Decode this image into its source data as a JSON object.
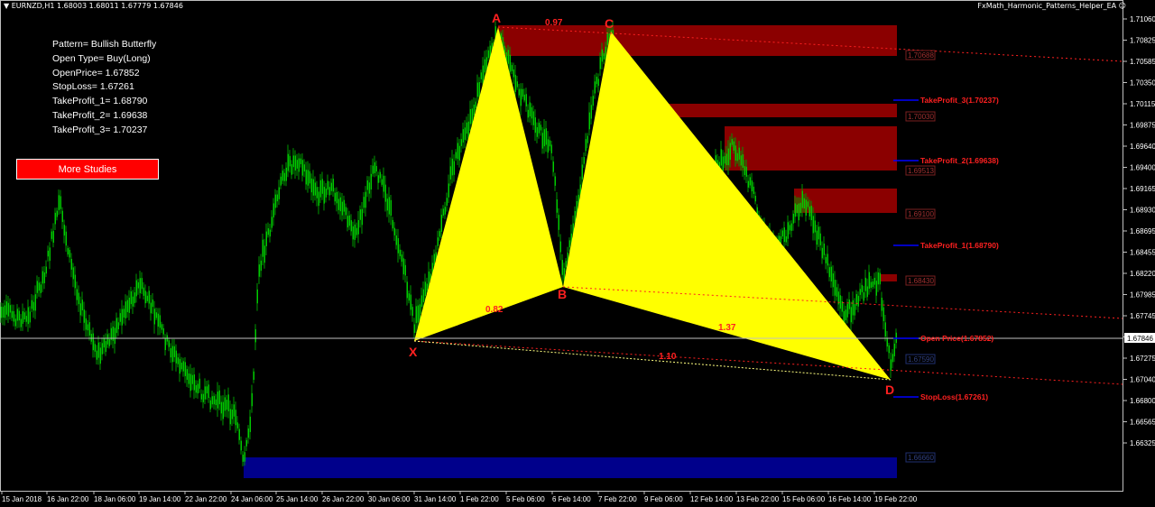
{
  "window": {
    "symbol_header": "EURNZD,H1  1.68003 1.68011 1.67779 1.67846",
    "ea_title": "FxMath_Harmonic_Patterns_Helper_EA"
  },
  "info_panel": {
    "lines": [
      "Pattern= Bullish Butterfly",
      "Open Type= Buy(Long)",
      "OpenPrice= 1.67852",
      "StopLoss= 1.67261",
      "TakeProfit_1= 1.68790",
      "TakeProfit_2= 1.69638",
      "TakeProfit_3= 1.70237"
    ],
    "button_label": "More Studies"
  },
  "colors": {
    "background": "#000000",
    "candles": "#00cc00",
    "pattern_fill": "#ffff00",
    "zone_red": "#8b0000",
    "zone_blue": "#00008b",
    "labels_red": "#ff2020",
    "level_lines": "#0000ff"
  },
  "price_axis": {
    "ticks": [
      "1.71060",
      "1.70825",
      "1.70585",
      "1.70350",
      "1.70115",
      "1.69875",
      "1.69640",
      "1.69400",
      "1.69165",
      "1.68930",
      "1.68695",
      "1.68455",
      "1.68220",
      "1.67985",
      "1.67745",
      "1.67510",
      "1.67275",
      "1.67040",
      "1.66800",
      "1.66565",
      "1.66325"
    ],
    "current_price": "1.67846"
  },
  "time_axis": {
    "ticks": [
      "15 Jan 2018",
      "16 Jan 22:00",
      "18 Jan 06:00",
      "19 Jan 14:00",
      "22 Jan 22:00",
      "24 Jan 06:00",
      "25 Jan 14:00",
      "26 Jan 22:00",
      "30 Jan 06:00",
      "31 Jan 14:00",
      "1 Feb 22:00",
      "5 Feb 06:00",
      "6 Feb 14:00",
      "7 Feb 22:00",
      "9 Feb 06:00",
      "12 Feb 14:00",
      "13 Feb 22:00",
      "15 Feb 06:00",
      "16 Feb 14:00",
      "19 Feb 22:00"
    ]
  },
  "pattern": {
    "points": [
      {
        "name": "X",
        "price": 1.6781
      },
      {
        "name": "A",
        "price": 1.7108
      },
      {
        "name": "B",
        "price": 1.6837
      },
      {
        "name": "C",
        "price": 1.7098
      },
      {
        "name": "D",
        "price": 1.6742
      }
    ],
    "ratios": [
      "0.97",
      "0.82",
      "1.37",
      "1.10"
    ]
  },
  "levels": [
    {
      "label": "TakeProfit_3(1.70237)",
      "price": 1.70237
    },
    {
      "label": "TakeProfit_2(1.69638)",
      "price": 1.69638
    },
    {
      "label": "TakeProfit_1(1.68790)",
      "price": 1.6879
    },
    {
      "label": "Open Price(1.67852)",
      "price": 1.67852
    },
    {
      "label": "StopLoss(1.67261)",
      "price": 1.67261
    }
  ],
  "zone_labels": [
    "1.70688",
    "1.70030",
    "1.69513",
    "1.69100",
    "1.68430",
    "1.67590",
    "1.66660"
  ]
}
